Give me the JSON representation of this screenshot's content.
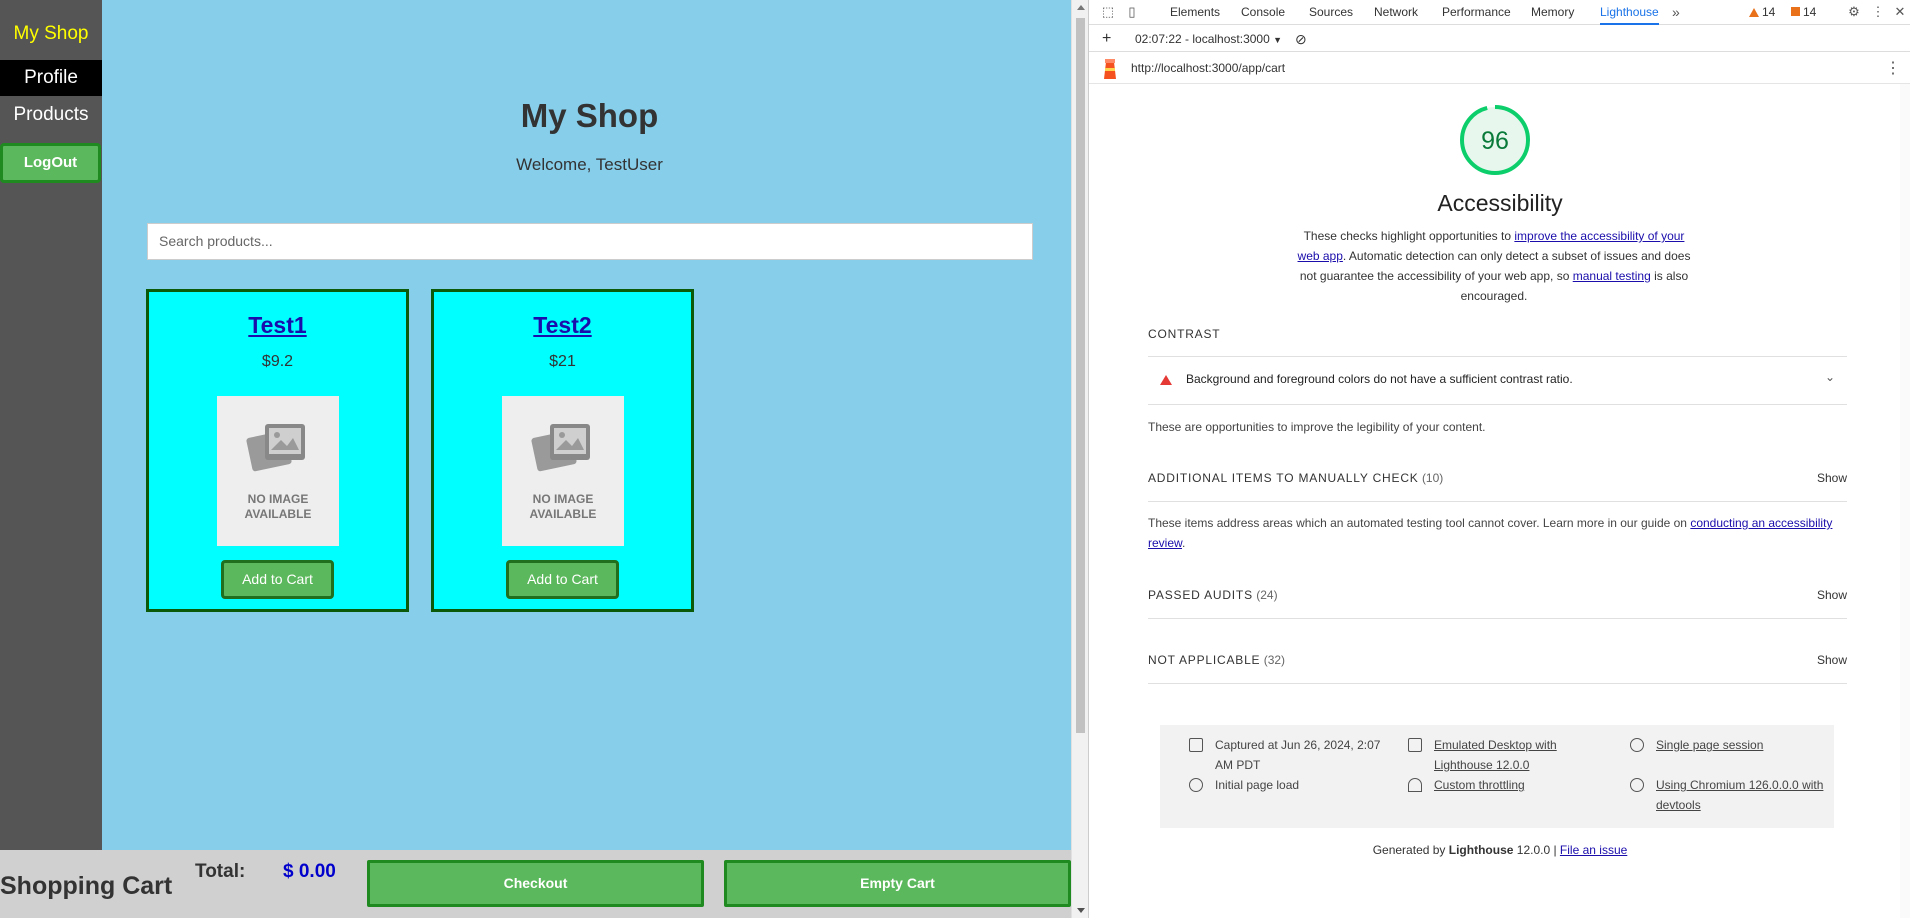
{
  "app": {
    "brand": "My Shop",
    "nav": {
      "profile": "Profile",
      "products": "Products",
      "logout": "LogOut"
    },
    "title": "My Shop",
    "welcome": "Welcome, TestUser",
    "search_placeholder": "Search products...",
    "products": [
      {
        "name": "Test1",
        "price": "$9.2",
        "image_text_1": "NO IMAGE",
        "image_text_2": "AVAILABLE",
        "button": "Add to Cart"
      },
      {
        "name": "Test2",
        "price": "$21",
        "image_text_1": "NO IMAGE",
        "image_text_2": "AVAILABLE",
        "button": "Add to Cart"
      }
    ],
    "cart": {
      "title": "Shopping Cart",
      "total_label": "Total:",
      "total_value": "$ 0.00",
      "checkout": "Checkout",
      "empty": "Empty Cart"
    }
  },
  "devtools": {
    "tabs": [
      "Elements",
      "Console",
      "Sources",
      "Network",
      "Performance",
      "Memory",
      "Lighthouse"
    ],
    "active_tab": "Lighthouse",
    "warnings_count": "14",
    "issues_count": "14",
    "toolbar_session": "02:07:22 - localhost:3000",
    "report_url": "http://localhost:3000/app/cart",
    "score": "96",
    "category": "Accessibility",
    "desc_1": "These checks highlight opportunities to ",
    "desc_link_1": "improve the accessibility of your web app",
    "desc_2": ". Automatic detection can only detect a subset of issues and does not guarantee the accessibility of your web app, so ",
    "desc_link_2": "manual testing",
    "desc_3": " is also encouraged.",
    "contrast_head": "CONTRAST",
    "contrast_audit": "Background and foreground colors do not have a sufficient contrast ratio.",
    "contrast_note": "These are opportunities to improve the legibility of your content.",
    "manual_head": "ADDITIONAL ITEMS TO MANUALLY CHECK",
    "manual_count": "(10)",
    "manual_note": "These items address areas which an automated testing tool cannot cover. Learn more in our guide on ",
    "manual_note_link": "conducting an accessibility review",
    "passed_head": "PASSED AUDITS",
    "passed_count": "(24)",
    "na_head": "NOT APPLICABLE",
    "na_count": "(32)",
    "show": "Show",
    "env": {
      "captured": "Captured at Jun 26, 2024, 2:07 AM PDT",
      "initial": "Initial page load",
      "emulated": "Emulated Desktop with Lighthouse 12.0.0",
      "throttling": "Custom throttling",
      "session": "Single page session",
      "chromium": "Using Chromium 126.0.0.0 with devtools"
    },
    "footer_prefix": "Generated by ",
    "footer_product": "Lighthouse",
    "footer_version": " 12.0.0 | ",
    "footer_link": "File an issue"
  },
  "colors": {
    "app_bg": "#87ceeb",
    "sidebar_bg": "#555555",
    "brand": "#ffff00",
    "card_bg": "#00ffff",
    "button_green": "#5cb85c",
    "score_green": "#0cce6b",
    "link_blue": "#1a0dab"
  }
}
